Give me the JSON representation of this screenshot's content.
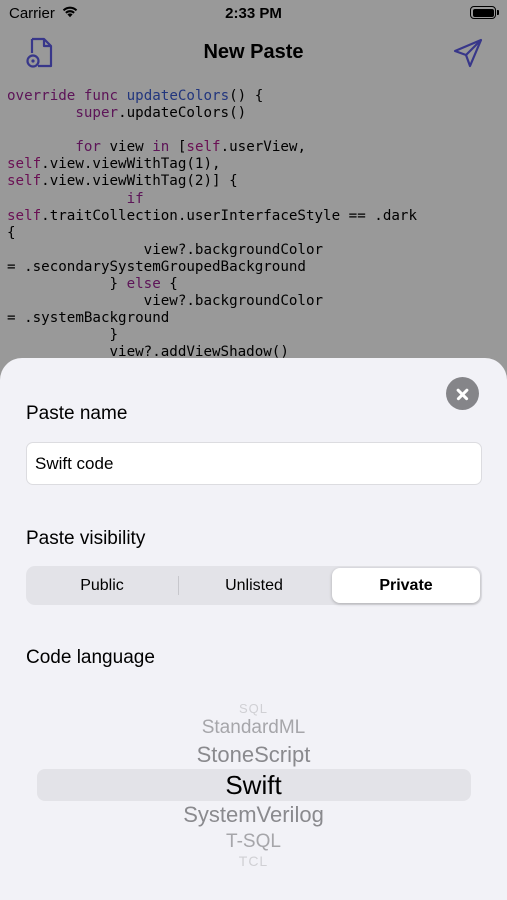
{
  "status_bar": {
    "carrier": "Carrier",
    "time": "2:33 PM"
  },
  "nav": {
    "title": "New Paste",
    "left_icon": "document-settings-icon",
    "right_icon": "paper-plane-icon"
  },
  "code_lines": [
    "override func updateColors() {",
    "        super.updateColors()",
    "",
    "        for view in [self.userView,",
    "self.view.viewWithTag(1),",
    "self.view.viewWithTag(2)] {",
    "              if",
    "self.traitCollection.userInterfaceStyle == .dark",
    "{",
    "                view?.backgroundColor",
    "= .secondarySystemGroupedBackground",
    "            } else {",
    "                view?.backgroundColor",
    "= .systemBackground",
    "            }",
    "            view?.addViewShadow()"
  ],
  "sheet": {
    "close_icon": "close-icon",
    "paste_name_label": "Paste name",
    "paste_name_value": "Swift code",
    "visibility_label": "Paste visibility",
    "visibility_options": [
      "Public",
      "Unlisted",
      "Private"
    ],
    "visibility_selected": "Private",
    "language_label": "Code language",
    "language_options": [
      "SQL",
      "StandardML",
      "StoneScript",
      "Swift",
      "SystemVerilog",
      "T-SQL",
      "TCL"
    ],
    "language_selected": "Swift"
  },
  "colors": {
    "accent": "#5e5ce6",
    "keyword": "#9b2393",
    "function": "#3a5bd1"
  }
}
